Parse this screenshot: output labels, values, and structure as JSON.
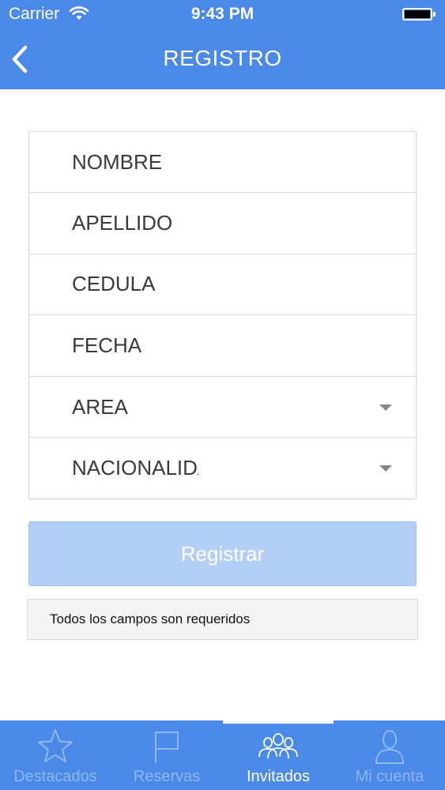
{
  "status_bar": {
    "carrier": "Carrier",
    "time": "9:43 PM"
  },
  "header": {
    "title": "REGISTRO",
    "back_icon": "chevron-left-icon"
  },
  "form": {
    "nombre_placeholder": "NOMBRE",
    "apellido_placeholder": "APELLIDO",
    "cedula_placeholder": "CEDULA",
    "fecha_placeholder": "FECHA",
    "area_value": "AREA",
    "nacionalidad_value": "NACIONALIDAD"
  },
  "actions": {
    "register_label": "Registrar"
  },
  "note": {
    "text": "Todos los campos son requeridos"
  },
  "tabbar": {
    "items": [
      {
        "label": "Destacados",
        "icon": "star-icon"
      },
      {
        "label": "Reservas",
        "icon": "flag-icon"
      },
      {
        "label": "Invitados",
        "icon": "group-icon"
      },
      {
        "label": "Mi cuenta",
        "icon": "person-icon"
      }
    ],
    "active_index": 2
  },
  "colors": {
    "primary": "#4a89e8",
    "button_disabled": "#b3cff6",
    "tab_inactive": "#8fb6ef"
  }
}
